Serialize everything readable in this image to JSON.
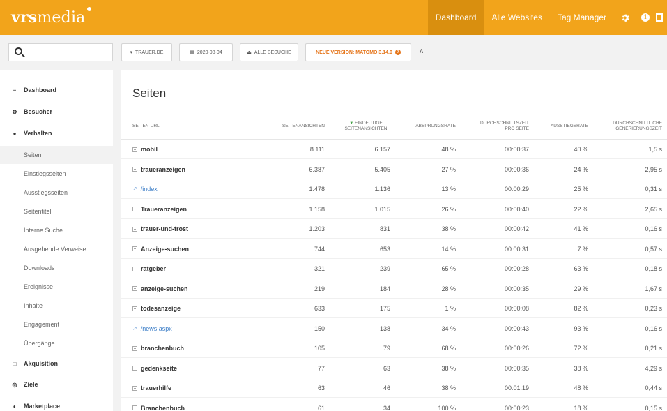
{
  "header": {
    "logo_main": "vrs",
    "logo_rest": "media",
    "nav": [
      {
        "label": "Dashboard",
        "active": true
      },
      {
        "label": "Alle Websites",
        "active": false
      },
      {
        "label": "Tag Manager",
        "active": false
      }
    ],
    "icons": [
      "gear-icon",
      "info-icon",
      "window-icon"
    ],
    "brand_color": "#f2a41b"
  },
  "toolbar": {
    "site": "TRAUER.DE",
    "date": "2020-08-04",
    "segment": "ALLE BESUCHE",
    "update": "NEUE VERSION: MATOMO 3.14.0",
    "collapse": "∧"
  },
  "sidebar": {
    "items": [
      {
        "label": "Dashboard",
        "icon": "≡",
        "type": "top"
      },
      {
        "label": "Besucher",
        "icon": "⚙",
        "type": "top"
      },
      {
        "label": "Verhalten",
        "icon": "●",
        "type": "top"
      },
      {
        "label": "Seiten",
        "type": "sub",
        "active": true
      },
      {
        "label": "Einstiegsseiten",
        "type": "sub"
      },
      {
        "label": "Ausstiegsseiten",
        "type": "sub"
      },
      {
        "label": "Seitentitel",
        "type": "sub"
      },
      {
        "label": "Interne Suche",
        "type": "sub"
      },
      {
        "label": "Ausgehende Verweise",
        "type": "sub"
      },
      {
        "label": "Downloads",
        "type": "sub"
      },
      {
        "label": "Ereignisse",
        "type": "sub"
      },
      {
        "label": "Inhalte",
        "type": "sub"
      },
      {
        "label": "Engagement",
        "type": "sub"
      },
      {
        "label": "Übergänge",
        "type": "sub"
      },
      {
        "label": "Akquisition",
        "icon": "□",
        "type": "top"
      },
      {
        "label": "Ziele",
        "icon": "◎",
        "type": "top"
      },
      {
        "label": "Marketplace",
        "icon": "◐",
        "type": "top"
      }
    ]
  },
  "report": {
    "title": "Seiten",
    "columns": [
      "SEITEN-URL",
      "SEITENANSICHTEN",
      "EINDEUTIGE SEITENANSICHTEN",
      "ABSPRUNGSRATE",
      "DURCHSCHNITTSZEIT PRO SEITE",
      "AUSSTIEGSRATE",
      "DURCHSCHNITTLICHE GENERIERUNGSZEIT"
    ],
    "sort_arrow": "▼",
    "rows": [
      {
        "label": "mobil",
        "link": false,
        "views": "8.111",
        "unique": "6.157",
        "bounce": "48 %",
        "avg": "00:00:37",
        "exit": "40 %",
        "gen": "1,5 s"
      },
      {
        "label": "traueranzeigen",
        "link": false,
        "views": "6.387",
        "unique": "5.405",
        "bounce": "27 %",
        "avg": "00:00:36",
        "exit": "24 %",
        "gen": "2,95 s"
      },
      {
        "label": "/index",
        "link": true,
        "views": "1.478",
        "unique": "1.136",
        "bounce": "13 %",
        "avg": "00:00:29",
        "exit": "25 %",
        "gen": "0,31 s"
      },
      {
        "label": "Traueranzeigen",
        "link": false,
        "views": "1.158",
        "unique": "1.015",
        "bounce": "26 %",
        "avg": "00:00:40",
        "exit": "22 %",
        "gen": "2,65 s"
      },
      {
        "label": "trauer-und-trost",
        "link": false,
        "views": "1.203",
        "unique": "831",
        "bounce": "38 %",
        "avg": "00:00:42",
        "exit": "41 %",
        "gen": "0,16 s"
      },
      {
        "label": "Anzeige-suchen",
        "link": false,
        "views": "744",
        "unique": "653",
        "bounce": "14 %",
        "avg": "00:00:31",
        "exit": "7 %",
        "gen": "0,57 s"
      },
      {
        "label": "ratgeber",
        "link": false,
        "views": "321",
        "unique": "239",
        "bounce": "65 %",
        "avg": "00:00:28",
        "exit": "63 %",
        "gen": "0,18 s"
      },
      {
        "label": "anzeige-suchen",
        "link": false,
        "views": "219",
        "unique": "184",
        "bounce": "28 %",
        "avg": "00:00:35",
        "exit": "29 %",
        "gen": "1,67 s"
      },
      {
        "label": "todesanzeige",
        "link": false,
        "views": "633",
        "unique": "175",
        "bounce": "1 %",
        "avg": "00:00:08",
        "exit": "82 %",
        "gen": "0,23 s"
      },
      {
        "label": "/news.aspx",
        "link": true,
        "views": "150",
        "unique": "138",
        "bounce": "34 %",
        "avg": "00:00:43",
        "exit": "93 %",
        "gen": "0,16 s"
      },
      {
        "label": "branchenbuch",
        "link": false,
        "views": "105",
        "unique": "79",
        "bounce": "68 %",
        "avg": "00:00:26",
        "exit": "72 %",
        "gen": "0,21 s"
      },
      {
        "label": "gedenkseite",
        "link": false,
        "views": "77",
        "unique": "63",
        "bounce": "38 %",
        "avg": "00:00:35",
        "exit": "38 %",
        "gen": "4,29 s"
      },
      {
        "label": "trauerhilfe",
        "link": false,
        "views": "63",
        "unique": "46",
        "bounce": "38 %",
        "avg": "00:01:19",
        "exit": "48 %",
        "gen": "0,44 s"
      },
      {
        "label": "Branchenbuch",
        "link": false,
        "views": "61",
        "unique": "34",
        "bounce": "100 %",
        "avg": "00:00:23",
        "exit": "18 %",
        "gen": "0,15 s"
      }
    ]
  }
}
